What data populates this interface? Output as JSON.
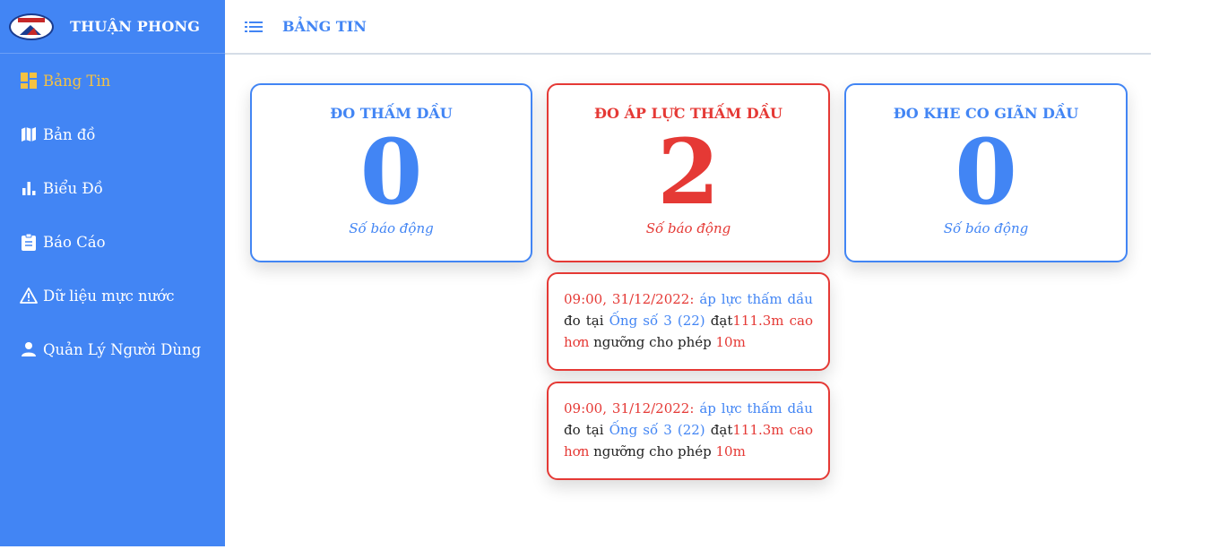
{
  "brand": {
    "name": "THUẬN PHONG",
    "logo_text": "THUẬN PHONG"
  },
  "sidebar": {
    "items": [
      {
        "label": "Bảng Tin",
        "icon": "dashboard-icon",
        "active": true
      },
      {
        "label": "Bản đồ",
        "icon": "map-icon",
        "active": false
      },
      {
        "label": "Biểu Đồ",
        "icon": "bar-chart-icon",
        "active": false
      },
      {
        "label": "Báo Cáo",
        "icon": "clipboard-icon",
        "active": false
      },
      {
        "label": "Dữ liệu mực nước",
        "icon": "warning-icon",
        "active": false
      },
      {
        "label": "Quản Lý Người Dùng",
        "icon": "user-icon",
        "active": false
      }
    ]
  },
  "header": {
    "title": "BẢNG TIN",
    "menu_icon": "list-icon"
  },
  "cards": [
    {
      "title": "ĐO THẤM DẦU",
      "count": "0",
      "subtitle": "Số báo động",
      "color": "#4285f4"
    },
    {
      "title": "ĐO ÁP LỰC THẤM DẦU",
      "count": "2",
      "subtitle": "Số báo động",
      "color": "#e53935"
    },
    {
      "title": "ĐO KHE CO GIÃN DẦU",
      "count": "0",
      "subtitle": "Số báo động",
      "color": "#4285f4"
    }
  ],
  "alerts": [
    {
      "time": "09:00, 31/12/2022:",
      "type": "áp lực thấm dầu",
      "text1": "đo tại",
      "location": "Ống số 3 (22)",
      "text2": "đạt",
      "value": "111.3m",
      "comparison": "cao hơn",
      "text3": "ngưỡng cho phép",
      "threshold": "10m"
    },
    {
      "time": "09:00, 31/12/2022:",
      "type": "áp lực thấm dầu",
      "text1": "đo tại",
      "location": "Ống số 3 (22)",
      "text2": "đạt",
      "value": "111.3m",
      "comparison": "cao hơn",
      "text3": "ngưỡng cho phép",
      "threshold": "10m"
    }
  ],
  "colors": {
    "primary": "#4285f4",
    "danger": "#e53935",
    "active_nav": "#f5c242"
  }
}
